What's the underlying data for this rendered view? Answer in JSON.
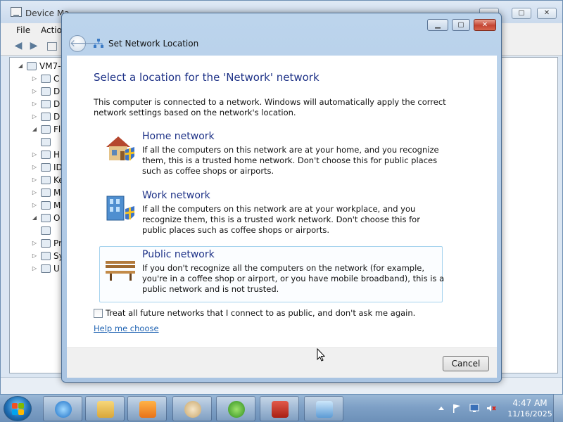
{
  "device_manager": {
    "title": "Device Ma",
    "menu": [
      "File",
      "Actio"
    ],
    "tree": [
      {
        "label": "VM7-",
        "expander": "◢"
      },
      {
        "label": "C",
        "expander": "▷"
      },
      {
        "label": "D",
        "expander": "▷"
      },
      {
        "label": "D",
        "expander": "▷"
      },
      {
        "label": "D",
        "expander": "▷"
      },
      {
        "label": "Fl",
        "expander": "◢"
      },
      {
        "label": "",
        "expander": ""
      },
      {
        "label": "H",
        "expander": "▷"
      },
      {
        "label": "ID",
        "expander": "▷"
      },
      {
        "label": "Ke",
        "expander": "▷"
      },
      {
        "label": "M",
        "expander": "▷"
      },
      {
        "label": "M",
        "expander": "▷"
      },
      {
        "label": "O",
        "expander": "◢"
      },
      {
        "label": "",
        "expander": ""
      },
      {
        "label": "Pr",
        "expander": "▷"
      },
      {
        "label": "Sy",
        "expander": "▷"
      },
      {
        "label": "U",
        "expander": "▷"
      }
    ]
  },
  "dialog": {
    "title": "Set Network Location",
    "heading": "Select a location for the 'Network' network",
    "intro": "This computer is connected to a network. Windows will automatically apply the correct network settings based on the network's location.",
    "options": [
      {
        "title": "Home network",
        "description": "If all the computers on this network are at your home, and you recognize them, this is a trusted home network.  Don't choose this for public places such as coffee shops or airports.",
        "selected": false
      },
      {
        "title": "Work network",
        "description": "If all the computers on this network are at your workplace, and you recognize them, this is a trusted work network.  Don't choose this for public places such as coffee shops or airports.",
        "selected": false
      },
      {
        "title": "Public network",
        "description": "If you don't recognize all the computers on the network (for example, you're in a coffee shop or airport, or you have mobile broadband), this is a public network and is not trusted.",
        "selected": true
      }
    ],
    "checkbox_label": "Treat all future networks that I connect to as public, and don't ask me again.",
    "checkbox_checked": false,
    "help_link": "Help me choose",
    "cancel_label": "Cancel"
  },
  "taskbar": {
    "pinned": [
      "internet-explorer",
      "windows-explorer",
      "media-player",
      "paint",
      "media-center",
      "toolbox",
      "control-panel"
    ],
    "clock_time": "4:47 AM",
    "clock_date": "11/16/2025"
  },
  "colors": {
    "heading_blue": "#1e3287",
    "link_blue": "#1e62b2",
    "selection_border": "#a6d3ee",
    "close_red": "#c44532"
  }
}
